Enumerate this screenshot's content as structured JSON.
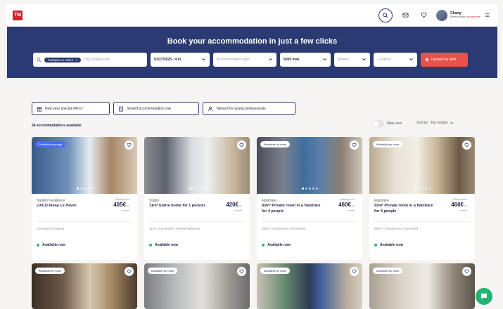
{
  "logo": "TM",
  "user": {
    "name": "Chang",
    "sub": "Rental stand",
    "sub_highlight": "incomplete"
  },
  "hero": {
    "title": "Book your accommodation in just a few clicks"
  },
  "filters": {
    "campus_chip": "Campus Le Havre",
    "city_placeholder": "City, postal code...",
    "date": "01/27/2025 - 4 m",
    "type": "Accommodation type",
    "budget": "500€ max.",
    "rooms": "Rooms",
    "criteria": "+ criteria",
    "alert": "Update my alert"
  },
  "quick_filters": [
    {
      "label": "New year special offers !"
    },
    {
      "label": "Shared accommodation only"
    },
    {
      "label": "Tailored for young professionals"
    }
  ],
  "results": {
    "count": "34 accommodations available",
    "map_view": "Map view",
    "sort": "Sort by : Top results"
  },
  "cards": [
    {
      "badge": "Protection synergy",
      "badge_style": "blue",
      "type": "Student residence",
      "title": "UXCO Fleep Le Havre",
      "price_from": "Starting from",
      "price": "405€",
      "price_sub": "cc",
      "price_period": "/ month",
      "features": "Furnished • Parking",
      "availability": "Available now",
      "img": "room1"
    },
    {
      "badge": "",
      "badge_style": "",
      "type": "Studio",
      "title": "11m² Entire home for 1 person",
      "price_from": "",
      "price": "420€",
      "price_sub": "cc",
      "price_period": "/ month",
      "features": "11m² • Furnished • Private bathroom",
      "availability": "Available now",
      "img": "room2"
    },
    {
      "badge": "Bookable by room",
      "badge_style": "white",
      "type": "Flatshare",
      "title": "93m² Private room in a flatshare for 4 people",
      "price_from": "Starting from",
      "price": "460€",
      "price_sub": "cc",
      "price_period": "/ month",
      "features": "93m² • 4 bedrooms • Furnished",
      "availability": "Available now",
      "img": "room3"
    },
    {
      "badge": "Bookable by room",
      "badge_style": "white",
      "type": "Flatshare",
      "title": "93m² Private room in a flatshare for 4 people",
      "price_from": "Starting from",
      "price": "460€",
      "price_sub": "cc",
      "price_period": "/ month",
      "features": "93m² • 4 bedrooms • Furnished",
      "availability": "Available now",
      "img": "room4"
    },
    {
      "badge": "Bookable by room",
      "badge_style": "white",
      "img": "room5"
    },
    {
      "badge": "Bookable by room",
      "badge_style": "white",
      "img": "room6"
    },
    {
      "badge": "Bookable by room",
      "badge_style": "white",
      "img": "room7"
    },
    {
      "badge": "Bookable by room",
      "badge_style": "white",
      "img": "room8"
    }
  ]
}
